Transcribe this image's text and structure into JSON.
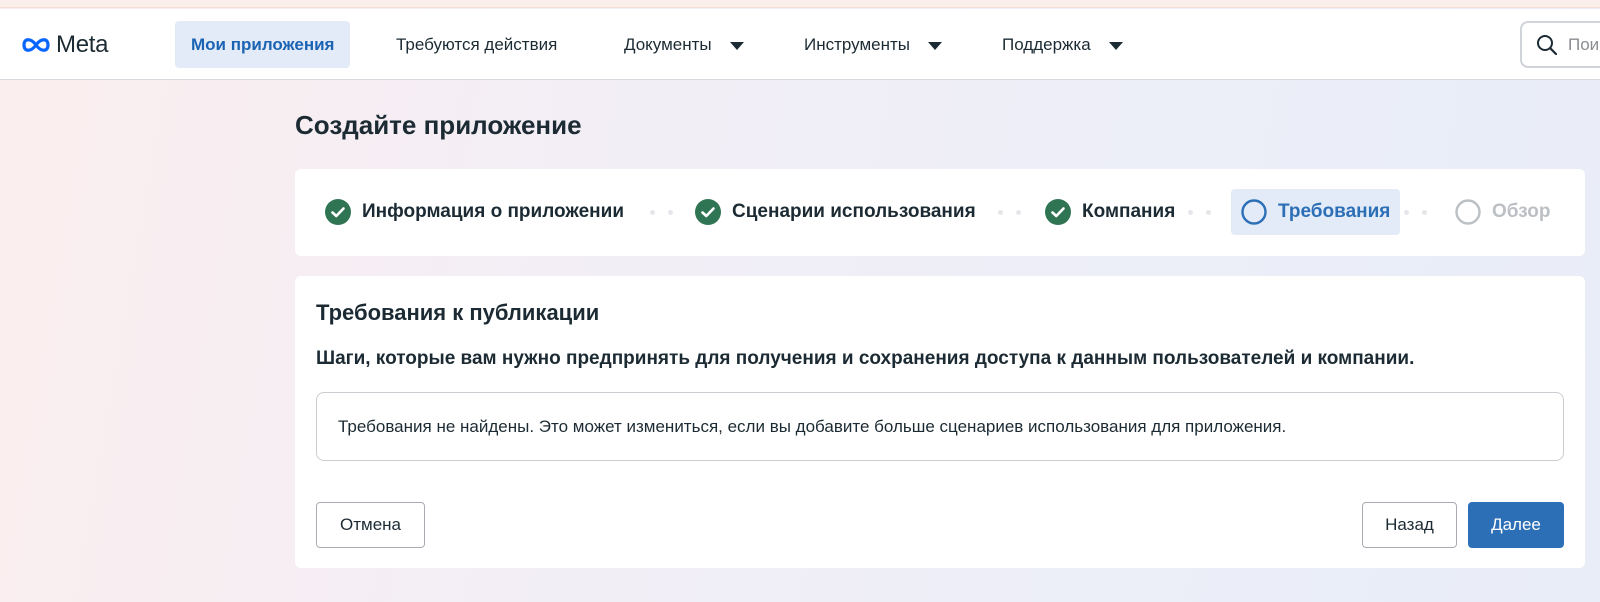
{
  "header": {
    "logo_text": "Meta",
    "nav": [
      {
        "label": "Мои приложения",
        "active": true
      },
      {
        "label": "Требуются действия",
        "has_dropdown": false
      },
      {
        "label": "Документы",
        "has_dropdown": true
      },
      {
        "label": "Инструменты",
        "has_dropdown": true
      },
      {
        "label": "Поддержка",
        "has_dropdown": true
      }
    ],
    "search_placeholder": "Пои",
    "search_icon": "search-icon"
  },
  "page": {
    "title": "Создайте приложение"
  },
  "stepper": {
    "steps": [
      {
        "label": "Информация о приложении",
        "status": "done"
      },
      {
        "label": "Сценарии использования",
        "status": "done"
      },
      {
        "label": "Компания",
        "status": "done"
      },
      {
        "label": "Требования",
        "status": "current"
      },
      {
        "label": "Обзор",
        "status": "pending"
      }
    ],
    "colors": {
      "done": "#2f7554",
      "current": "#2d6fb6",
      "pending": "#bcc0c4"
    }
  },
  "card": {
    "title": "Требования к публикации",
    "subtitle": "Шаги, которые вам нужно предпринять для получения и сохранения доступа к данным пользователей и компании.",
    "notice": "Требования не найдены. Это может измениться, если вы добавите больше сценариев использования для приложения.",
    "buttons": {
      "cancel": "Отмена",
      "back": "Назад",
      "next": "Далее"
    }
  },
  "colors": {
    "accent": "#2d6fb6",
    "active_nav_bg": "#e2ebf7"
  }
}
